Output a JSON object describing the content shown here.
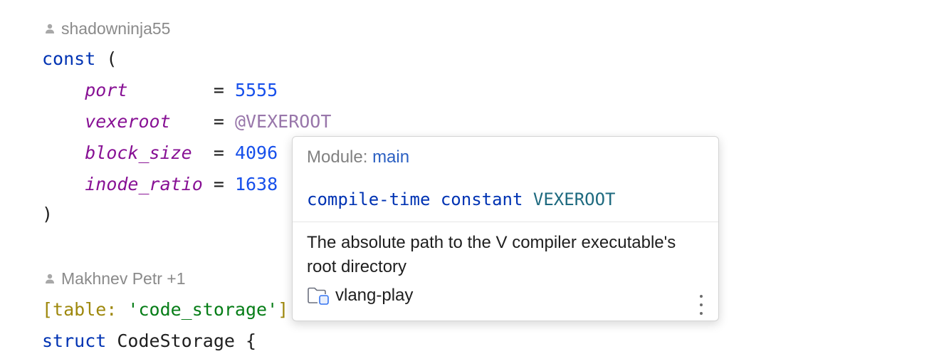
{
  "editor": {
    "block1_author": "shadowninja55",
    "block2_author": "Makhnev Petr +1",
    "code": {
      "const_kw": "const",
      "open_paren": " (",
      "close_paren": ")",
      "consts": [
        {
          "name": "port",
          "pad": "        = ",
          "value": "5555",
          "kind": "num"
        },
        {
          "name": "vexeroot",
          "pad": "    = ",
          "value": "@VEXEROOT",
          "kind": "ct"
        },
        {
          "name": "block_size",
          "pad": "  = ",
          "value": "4096",
          "kind": "num"
        },
        {
          "name": "inode_ratio",
          "pad": " = ",
          "value": "1638",
          "kind": "num"
        }
      ],
      "attr_open": "[table: ",
      "attr_value": "'code_storage'",
      "attr_close": "]",
      "struct_kw": "struct",
      "struct_rest": " CodeStorage {"
    }
  },
  "popup": {
    "module_label": "Module: ",
    "module_name": "main",
    "signature_kind": "compile-time constant",
    "signature_name": "VEXEROOT",
    "description": "The absolute path to the V compiler executable's root directory",
    "project_name": "vlang-play",
    "icons": {
      "project": "folder-module-icon",
      "more": "more-vertical-icon",
      "author": "person-icon"
    }
  }
}
